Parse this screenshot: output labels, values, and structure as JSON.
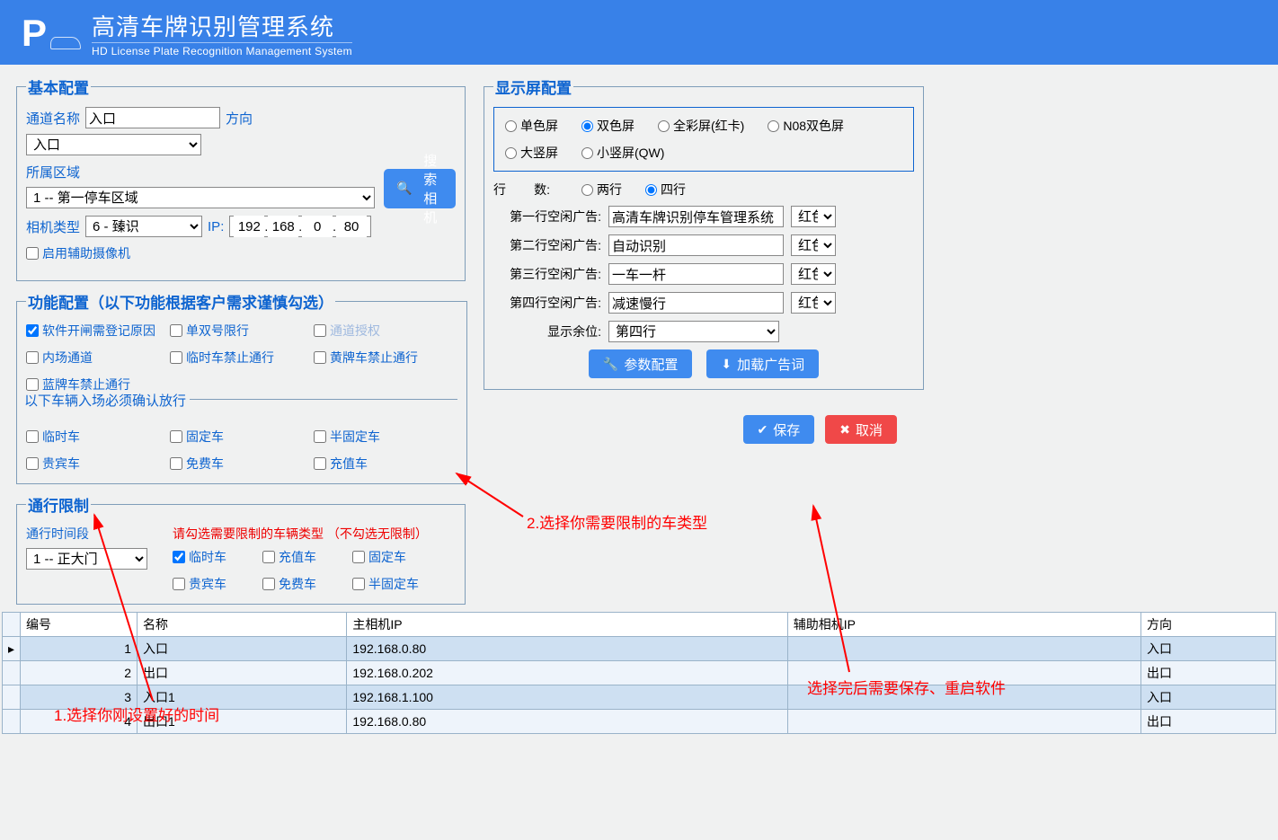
{
  "header": {
    "title_zh": "高清车牌识别管理系统",
    "title_en": "HD License Plate Recognition Management System"
  },
  "basic": {
    "legend": "基本配置",
    "channel_name_lbl": "通道名称",
    "channel_name": "入口",
    "direction_lbl": "方向",
    "direction": "入口",
    "area_lbl": "所属区域",
    "area": "1 -- 第一停车区域",
    "camera_type_lbl": "相机类型",
    "camera_type": "6 - 臻识",
    "ip_lbl": "IP:",
    "ip1": "192",
    "ip2": "168",
    "ip3": "0",
    "ip4": "80",
    "aux_cam_lbl": "启用辅助摄像机",
    "search_btn": "搜索相机"
  },
  "func": {
    "legend": "功能配置（以下功能根据客户需求谨慎勾选）",
    "items": [
      {
        "label": "软件开闸需登记原因",
        "checked": true
      },
      {
        "label": "单双号限行",
        "checked": false
      },
      {
        "label": "通道授权",
        "checked": false,
        "disabled": true
      },
      {
        "label": "内场通道",
        "checked": false
      },
      {
        "label": "临时车禁止通行",
        "checked": false
      },
      {
        "label": "黄牌车禁止通行",
        "checked": false
      },
      {
        "label": "蓝牌车禁止通行",
        "checked": false
      }
    ],
    "confirm_legend": "以下车辆入场必须确认放行",
    "confirm_items": [
      {
        "label": "临时车"
      },
      {
        "label": "固定车"
      },
      {
        "label": "半固定车"
      },
      {
        "label": "贵宾车"
      },
      {
        "label": "免费车"
      },
      {
        "label": "充值车"
      }
    ]
  },
  "restrict": {
    "legend": "通行限制",
    "period_lbl": "通行时间段",
    "period": "1 -- 正大门",
    "hint": "请勾选需要限制的车辆类型 （不勾选无限制）",
    "items": [
      {
        "label": "临时车",
        "checked": true
      },
      {
        "label": "充值车"
      },
      {
        "label": "固定车"
      },
      {
        "label": "贵宾车"
      },
      {
        "label": "免费车"
      },
      {
        "label": "半固定车"
      }
    ]
  },
  "screen": {
    "legend": "显示屏配置",
    "types": [
      "单色屏",
      "双色屏",
      "全彩屏(红卡)",
      "N08双色屏",
      "大竖屏",
      "小竖屏(QW)"
    ],
    "type_selected": 1,
    "rows_lbl": "行        数:",
    "rows_opts": [
      "两行",
      "四行"
    ],
    "rows_selected": 1,
    "ad1_lbl": "第一行空闲广告:",
    "ad1": "高清车牌识别停车管理系统",
    "color1": "红色",
    "ad2_lbl": "第二行空闲广告:",
    "ad2": "自动识别",
    "color2": "红色",
    "ad3_lbl": "第三行空闲广告:",
    "ad3": "一车一杆",
    "color3": "红色",
    "ad4_lbl": "第四行空闲广告:",
    "ad4": "减速慢行",
    "color4": "红色",
    "rem_lbl": "显示余位:",
    "rem": "第四行",
    "btn_param": "参数配置",
    "btn_load": "加载广告词"
  },
  "actions": {
    "save": "保存",
    "cancel": "取消"
  },
  "table": {
    "cols": [
      "编号",
      "名称",
      "主相机IP",
      "辅助相机IP",
      "方向"
    ],
    "rows": [
      {
        "id": "1",
        "name": "入口",
        "ip": "192.168.0.80",
        "aux": "",
        "dir": "入口"
      },
      {
        "id": "2",
        "name": "出口",
        "ip": "192.168.0.202",
        "aux": "",
        "dir": "出口"
      },
      {
        "id": "3",
        "name": "入口1",
        "ip": "192.168.1.100",
        "aux": "",
        "dir": "入口"
      },
      {
        "id": "4",
        "name": "出口1",
        "ip": "192.168.0.80",
        "aux": "",
        "dir": "出口"
      }
    ]
  },
  "annotations": {
    "a1": "1.选择你刚设置好的时间",
    "a2": "2.选择你需要限制的车类型",
    "a3": "选择完后需要保存、重启软件"
  }
}
